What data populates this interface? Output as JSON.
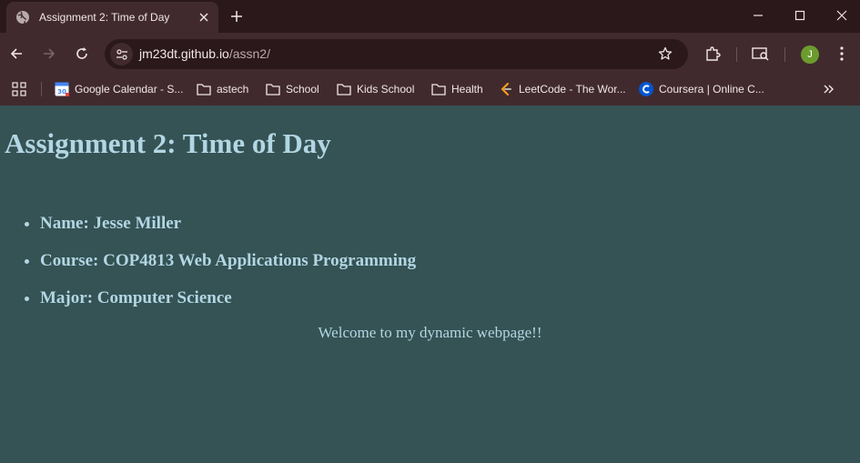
{
  "tab": {
    "title": "Assignment 2: Time of Day"
  },
  "address": {
    "host": "jm23dt.github.io",
    "path": "/assn2/"
  },
  "profile": {
    "initial": "J"
  },
  "bookmarks": [
    {
      "label": "Google Calendar - S...",
      "icon": "google-calendar-icon"
    },
    {
      "label": "astech",
      "icon": "folder-icon"
    },
    {
      "label": "School",
      "icon": "folder-icon"
    },
    {
      "label": "Kids School",
      "icon": "folder-icon"
    },
    {
      "label": "Health",
      "icon": "folder-icon"
    },
    {
      "label": "LeetCode - The Wor...",
      "icon": "leetcode-icon"
    },
    {
      "label": "Coursera | Online C...",
      "icon": "coursera-icon"
    }
  ],
  "page": {
    "title": "Assignment 2: Time of Day",
    "items": [
      "Name: Jesse Miller",
      "Course: COP4813 Web Applications Programming",
      "Major: Computer Science"
    ],
    "welcome": "Welcome to my dynamic webpage!!"
  },
  "colors": {
    "page_background": "#355254",
    "page_text": "#b2d6e3",
    "chrome_frame": "#2a181b",
    "chrome_toolbar": "#412a2e"
  }
}
